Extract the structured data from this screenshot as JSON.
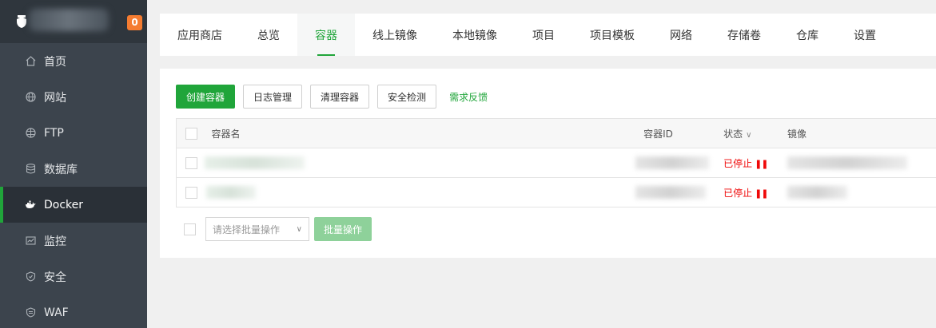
{
  "sidebar": {
    "badge": "0",
    "items": [
      {
        "label": "首页",
        "icon": "home-icon"
      },
      {
        "label": "网站",
        "icon": "globe-icon"
      },
      {
        "label": "FTP",
        "icon": "ftp-globe-icon"
      },
      {
        "label": "数据库",
        "icon": "database-icon"
      },
      {
        "label": "Docker",
        "icon": "docker-icon"
      },
      {
        "label": "监控",
        "icon": "monitor-icon"
      },
      {
        "label": "安全",
        "icon": "shield-icon"
      },
      {
        "label": "WAF",
        "icon": "waf-shield-icon"
      }
    ],
    "active_index": 4
  },
  "tabs": [
    "应用商店",
    "总览",
    "容器",
    "线上镜像",
    "本地镜像",
    "项目",
    "项目模板",
    "网络",
    "存储卷",
    "仓库",
    "设置"
  ],
  "active_tab": "容器",
  "toolbar": {
    "create": "创建容器",
    "logs": "日志管理",
    "clean": "清理容器",
    "security": "安全检测",
    "feedback": "需求反馈"
  },
  "table": {
    "headers": {
      "name": "容器名",
      "id": "容器ID",
      "status": "状态",
      "image": "镜像"
    },
    "rows": [
      {
        "status": "已停止"
      },
      {
        "status": "已停止"
      }
    ]
  },
  "batch": {
    "placeholder": "请选择批量操作",
    "button": "批量操作"
  },
  "colors": {
    "accent": "#20a53a",
    "sidebar_bg": "#3c444d",
    "stopped": "#ef0808",
    "badge": "#f57c31"
  }
}
